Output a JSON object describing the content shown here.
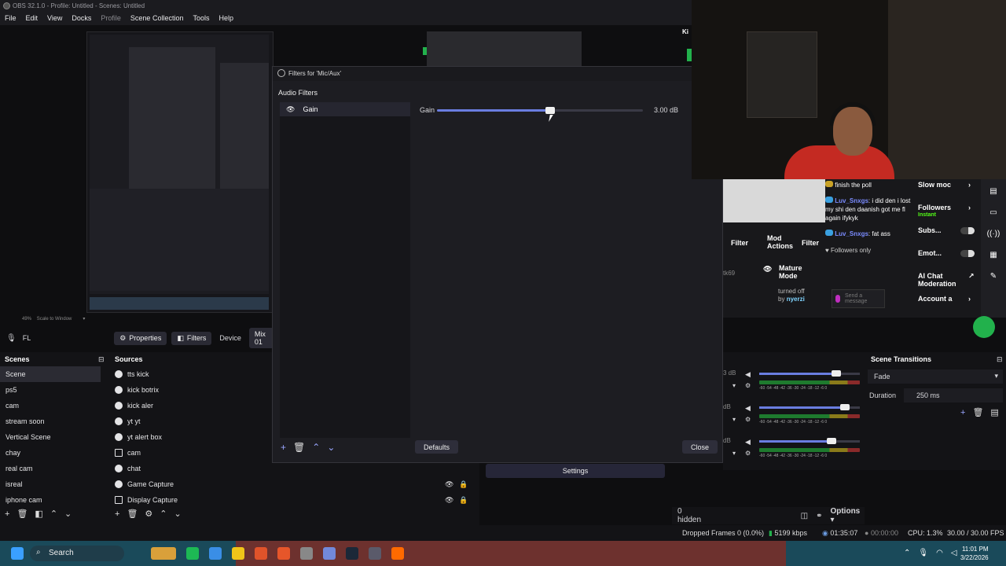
{
  "app": {
    "title": "OBS 32.1.0 - Profile: Untitled - Scenes: Untitled",
    "menu": [
      "File",
      "Edit",
      "View",
      "Docks",
      "Profile",
      "Scene Collection",
      "Tools",
      "Help"
    ]
  },
  "preview": {
    "scale_label": "Scale to Window",
    "zoom": "49%"
  },
  "dock_bar": {
    "source": "FL",
    "tabs": [
      "Properties",
      "Filters",
      "Device",
      "Mix 01"
    ]
  },
  "scenes": {
    "title": "Scenes",
    "items": [
      "Scene",
      "ps5",
      "cam",
      "stream soon",
      "Vertical Scene",
      "chay",
      "real cam",
      "isreal",
      "iphone cam"
    ]
  },
  "sources": {
    "title": "Sources",
    "items": [
      {
        "name": "tts kick",
        "icon": "globe-icon"
      },
      {
        "name": "kick botrix",
        "icon": "globe-icon"
      },
      {
        "name": "kick aler",
        "icon": "globe-icon"
      },
      {
        "name": "yt yt",
        "icon": "globe-icon"
      },
      {
        "name": "yt alert box",
        "icon": "globe-icon"
      },
      {
        "name": "cam",
        "icon": "list-icon"
      },
      {
        "name": "chat",
        "icon": "globe-icon"
      },
      {
        "name": "Game Capture",
        "icon": "gamepad-icon"
      },
      {
        "name": "Display Capture",
        "icon": "monitor-icon"
      }
    ]
  },
  "dialog": {
    "title": "Filters for 'Mic/Aux'",
    "section": "Audio Filters",
    "filters": [
      {
        "name": "Gain"
      }
    ],
    "gain_label": "Gain",
    "gain_value": "3.00 dB",
    "gain_level": 0.55,
    "defaults_label": "Defaults",
    "close_label": "Close"
  },
  "settings_label": "Settings",
  "chat": {
    "messages": [
      {
        "user": "",
        "text": "finish the poll"
      },
      {
        "user": "Luv_Snxgs",
        "text": ": i did den i lost my shi den daanish got me fl again ifykyk"
      },
      {
        "user": "Luv_Snxgs",
        "text": ": fat ass"
      }
    ],
    "followers_only": "Followers only",
    "send_placeholder": "Send a message",
    "filter_label": "Filter",
    "mod_actions": "Mod Actions",
    "mature_mode": "Mature Mode",
    "turned_off": "turned off",
    "by_label": "by",
    "by_user": "nyerzi",
    "left_partial": "tk69",
    "settings": [
      {
        "label": "Slow moc",
        "type": "chevron"
      },
      {
        "label": "Followers",
        "sub": "Instant",
        "type": "chevron"
      },
      {
        "label": "Subs...",
        "type": "toggle"
      },
      {
        "label": "Emot...",
        "type": "toggle"
      },
      {
        "label": "AI Chat Moderation",
        "type": "ext"
      },
      {
        "label": "Account a",
        "type": "chevron"
      }
    ]
  },
  "mixer": {
    "rows": [
      {
        "db": "3 dB",
        "level": 0.85
      },
      {
        "db": "dB",
        "level": 0.95
      },
      {
        "db": "dB",
        "level": 0.8
      }
    ],
    "scale": "-60 -54 -48 -42 -36 -30 -24 -18 -12 -6 0"
  },
  "transitions": {
    "title": "Scene Transitions",
    "type": "Fade",
    "duration_label": "Duration",
    "duration": "250 ms"
  },
  "hidden_label": "0 hidden",
  "options_label": "Options",
  "status": {
    "dropped": "Dropped Frames 0 (0.0%)",
    "kbps": "5199 kbps",
    "stream_time": "01:35:07",
    "rec_time": "00:00:00",
    "cpu": "CPU: 1.3%",
    "fps": "30.00 / 30.00 FPS"
  },
  "taskbar": {
    "search": "Search",
    "time": "11:01 PM",
    "date": "3/22/2026"
  },
  "colors": {
    "accent": "#6a7de0",
    "twitch": "#9147ff",
    "green": "#22b14c"
  }
}
